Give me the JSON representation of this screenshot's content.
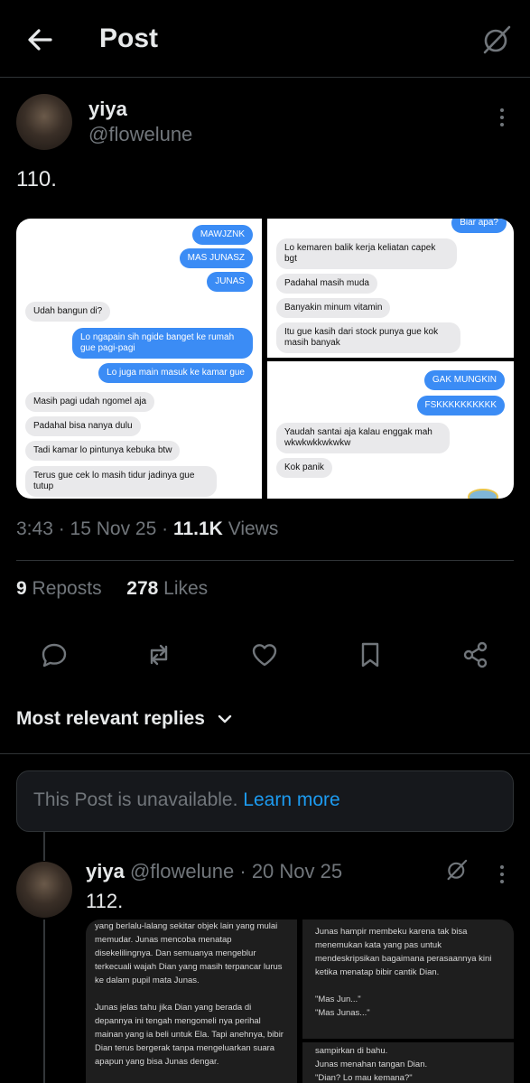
{
  "header": {
    "title": "Post",
    "back_icon": "arrow-left-icon",
    "grok_icon": "grok-icon"
  },
  "post": {
    "name": "yiya",
    "handle": "@flowelune",
    "text": "110.",
    "media": {
      "left_panel": [
        {
          "from": "out",
          "text": "MAWJZNK"
        },
        {
          "from": "out",
          "text": "MAS JUNASZ"
        },
        {
          "from": "out",
          "text": "JUNAS"
        },
        {
          "from": "in",
          "text": "Udah bangun di?"
        },
        {
          "from": "out",
          "text": "Lo ngapain sih ngide banget ke rumah gue pagi-pagi"
        },
        {
          "from": "out",
          "text": "Lo juga main masuk ke kamar gue"
        },
        {
          "from": "in",
          "text": "Masih pagi udah ngomel aja"
        },
        {
          "from": "in",
          "text": "Padahal bisa nanya dulu"
        },
        {
          "from": "in",
          "text": "Tadi kamar lo pintunya kebuka btw"
        },
        {
          "from": "in",
          "text": "Terus gue cek lo masih tidur jadinya gue tutup"
        }
      ],
      "right_top_panel": [
        {
          "from": "out",
          "text": "Biar apa?"
        },
        {
          "from": "in",
          "text": "Lo kemaren balik kerja keliatan capek bgt"
        },
        {
          "from": "in",
          "text": "Padahal masih muda"
        },
        {
          "from": "in",
          "text": "Banyakin minum vitamin"
        },
        {
          "from": "in",
          "text": "Itu gue kasih dari stock punya gue kok masih banyak"
        }
      ],
      "right_bottom_panel": [
        {
          "from": "out",
          "text": "GAK MUNGKIN"
        },
        {
          "from": "out",
          "text": "FSKKKKKKKKKK"
        },
        {
          "from": "in",
          "text": "Yaudah santai aja kalau enggak mah wkwkwkkwkwkw"
        },
        {
          "from": "in",
          "text": "Kok panik"
        }
      ]
    },
    "time": "3:43",
    "date": "15 Nov 25",
    "views_count": "11.1K",
    "views_label": "Views",
    "reposts_count": "9",
    "reposts_label": "Reposts",
    "likes_count": "278",
    "likes_label": "Likes"
  },
  "actions": [
    "reply-icon",
    "repost-icon",
    "like-icon",
    "bookmark-icon",
    "share-icon"
  ],
  "replies_header": "Most relevant replies",
  "unavailable": {
    "text": "This Post is unavailable.",
    "link": "Learn more"
  },
  "reply": {
    "name": "yiya",
    "handle": "@flowelune",
    "date": "· 20 Nov 25",
    "text": "112.",
    "left_panel_text": "yang berlalu-lalang sekitar objek lain yang mulai memudar. Junas mencoba menatap disekelilingnya. Dan semuanya mengeblur terkecuali wajah Dian yang masih terpancar lurus ke dalam pupil mata Junas.\n\nJunas jelas tahu jika Dian yang berada di depannya ini tengah mengomeli nya perihal mainan yang ia beli untuk Ela. Tapi anehnya, bibir Dian terus bergerak tanpa mengeluarkan suara apapun yang bisa Junas dengar.",
    "right_top_text": "Junas hampir membeku karena tak bisa menemukan kata yang pas untuk mendeskripsikan bagaimana perasaannya kini ketika menatap bibir cantik Dian.\n\n\"Mas Jun...\"\n\"Mas Junas...\"",
    "right_bottom_text": "sampirkan di bahu.\nJunas menahan tangan Dian.\n\"Dian? Lo mau kemana?\""
  }
}
